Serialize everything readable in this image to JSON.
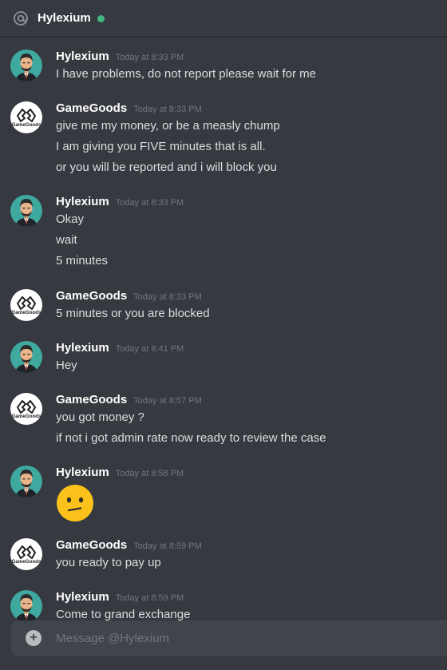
{
  "header": {
    "icon": "at-icon",
    "title": "Hylexium",
    "status_color": "#43b581"
  },
  "messages": [
    {
      "author": "Hylexium",
      "avatar": "hylexium-avatar",
      "time": "Today at 8:33 PM",
      "lines": [
        "I have problems, do not report please wait for me"
      ]
    },
    {
      "author": "GameGoods",
      "avatar": "gamegoods-avatar",
      "time": "Today at 8:33 PM",
      "lines": [
        "give me my money, or be a measly chump",
        "I am giving you FIVE minutes that is all.",
        "or you will be reported and i will block you"
      ]
    },
    {
      "author": "Hylexium",
      "avatar": "hylexium-avatar",
      "time": "Today at 8:33 PM",
      "lines": [
        "Okay",
        "wait",
        "5 minutes"
      ]
    },
    {
      "author": "GameGoods",
      "avatar": "gamegoods-avatar",
      "time": "Today at 8:33 PM",
      "lines": [
        "5 minutes or you are blocked"
      ]
    },
    {
      "author": "Hylexium",
      "avatar": "hylexium-avatar",
      "time": "Today at 8:41 PM",
      "lines": [
        "Hey"
      ]
    },
    {
      "author": "GameGoods",
      "avatar": "gamegoods-avatar",
      "time": "Today at 8:57 PM",
      "lines": [
        "you got money ?",
        "if not i got admin rate now ready to review the case"
      ]
    },
    {
      "author": "Hylexium",
      "avatar": "hylexium-avatar",
      "time": "Today at 8:58 PM",
      "emoji": "confused-face-emoji"
    },
    {
      "author": "GameGoods",
      "avatar": "gamegoods-avatar",
      "time": "Today at 8:59 PM",
      "lines": [
        "you ready to pay up"
      ]
    },
    {
      "author": "Hylexium",
      "avatar": "hylexium-avatar",
      "time": "Today at 8:59 PM",
      "lines": [
        "Come to grand exchange"
      ]
    }
  ],
  "gamegoods_logo_text": "GameGoods",
  "composer": {
    "icon": "plus-circle-icon",
    "placeholder": "Message @Hylexium"
  }
}
